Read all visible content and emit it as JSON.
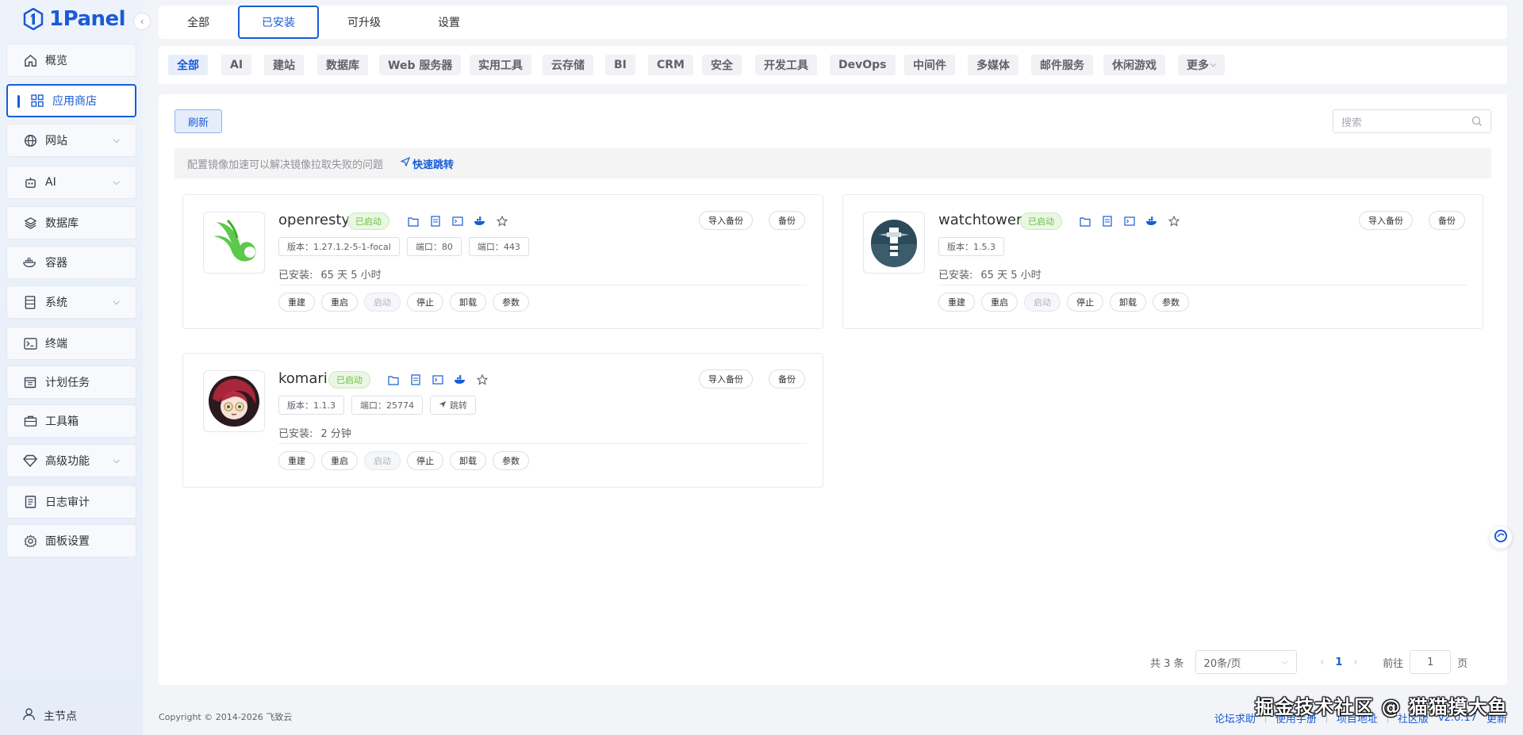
{
  "app": {
    "logo_text": "1Panel",
    "accent": "#1a5bd6"
  },
  "sidebar": {
    "items": [
      {
        "label": "概览",
        "icon": "home-icon",
        "has_children": false
      },
      {
        "label": "应用商店",
        "icon": "apps-icon",
        "has_children": false,
        "active": true
      },
      {
        "label": "网站",
        "icon": "globe-icon",
        "has_children": true
      },
      {
        "label": "AI",
        "icon": "robot-icon",
        "has_children": true
      },
      {
        "label": "数据库",
        "icon": "layers-icon",
        "has_children": false
      },
      {
        "label": "容器",
        "icon": "docker-icon",
        "has_children": false
      },
      {
        "label": "系统",
        "icon": "server-icon",
        "has_children": true
      },
      {
        "label": "终端",
        "icon": "terminal-icon",
        "has_children": false
      },
      {
        "label": "计划任务",
        "icon": "calendar-icon",
        "has_children": false
      },
      {
        "label": "工具箱",
        "icon": "toolbox-icon",
        "has_children": false
      },
      {
        "label": "高级功能",
        "icon": "diamond-icon",
        "has_children": true
      },
      {
        "label": "日志审计",
        "icon": "log-icon",
        "has_children": false
      },
      {
        "label": "面板设置",
        "icon": "gear-icon",
        "has_children": false
      }
    ],
    "node_label": "主节点"
  },
  "tabs": [
    {
      "label": "全部"
    },
    {
      "label": "已安装",
      "active": true
    },
    {
      "label": "可升级"
    },
    {
      "label": "设置"
    }
  ],
  "categories": [
    "全部",
    "AI",
    "建站",
    "数据库",
    "Web 服务器",
    "实用工具",
    "云存储",
    "BI",
    "CRM",
    "安全",
    "开发工具",
    "DevOps",
    "中间件",
    "多媒体",
    "邮件服务",
    "休闲游戏",
    "更多"
  ],
  "toolbar": {
    "refresh_label": "刷新",
    "search_placeholder": "搜索",
    "notice_text": "配置镜像加速可以解决镜像拉取失败的问题",
    "notice_link": "快速跳转"
  },
  "apps": [
    {
      "name": "openresty",
      "status": "已启动",
      "import_backup": "导入备份",
      "backup": "备份",
      "version": "版本：1.27.1.2-5-1-focal",
      "ports": [
        "端口：80",
        "端口：443"
      ],
      "installed_label": "已安装:",
      "installed_time": "65 天 5 小时",
      "actions": [
        "重建",
        "重启",
        "启动",
        "停止",
        "卸载",
        "参数"
      ],
      "disabled_action": "启动"
    },
    {
      "name": "watchtower",
      "status": "已启动",
      "import_backup": "导入备份",
      "backup": "备份",
      "version": "版本：1.5.3",
      "ports": [],
      "installed_label": "已安装:",
      "installed_time": "65 天 5 小时",
      "actions": [
        "重建",
        "重启",
        "启动",
        "停止",
        "卸载",
        "参数"
      ],
      "disabled_action": "启动"
    },
    {
      "name": "komari",
      "status": "已启动",
      "import_backup": "导入备份",
      "backup": "备份",
      "version": "版本：1.1.3",
      "ports": [
        "端口：25774"
      ],
      "jump": "跳转",
      "installed_label": "已安装:",
      "installed_time": "2 分钟",
      "actions": [
        "重建",
        "重启",
        "启动",
        "停止",
        "卸载",
        "参数"
      ],
      "disabled_action": "启动"
    }
  ],
  "pagination": {
    "total": "共 3 条",
    "page_size": "20条/页",
    "current_page": "1",
    "goto_label": "前往",
    "goto_value": "1",
    "page_suffix": "页"
  },
  "footer": {
    "copyright": "Copyright © 2014-2026 飞致云",
    "links": [
      "论坛求助",
      "使用手册",
      "项目地址",
      "社区版"
    ],
    "version": "v2.0.17",
    "update": "更新"
  },
  "watermark": "掘金技术社区 @ 猫猫摸大鱼"
}
